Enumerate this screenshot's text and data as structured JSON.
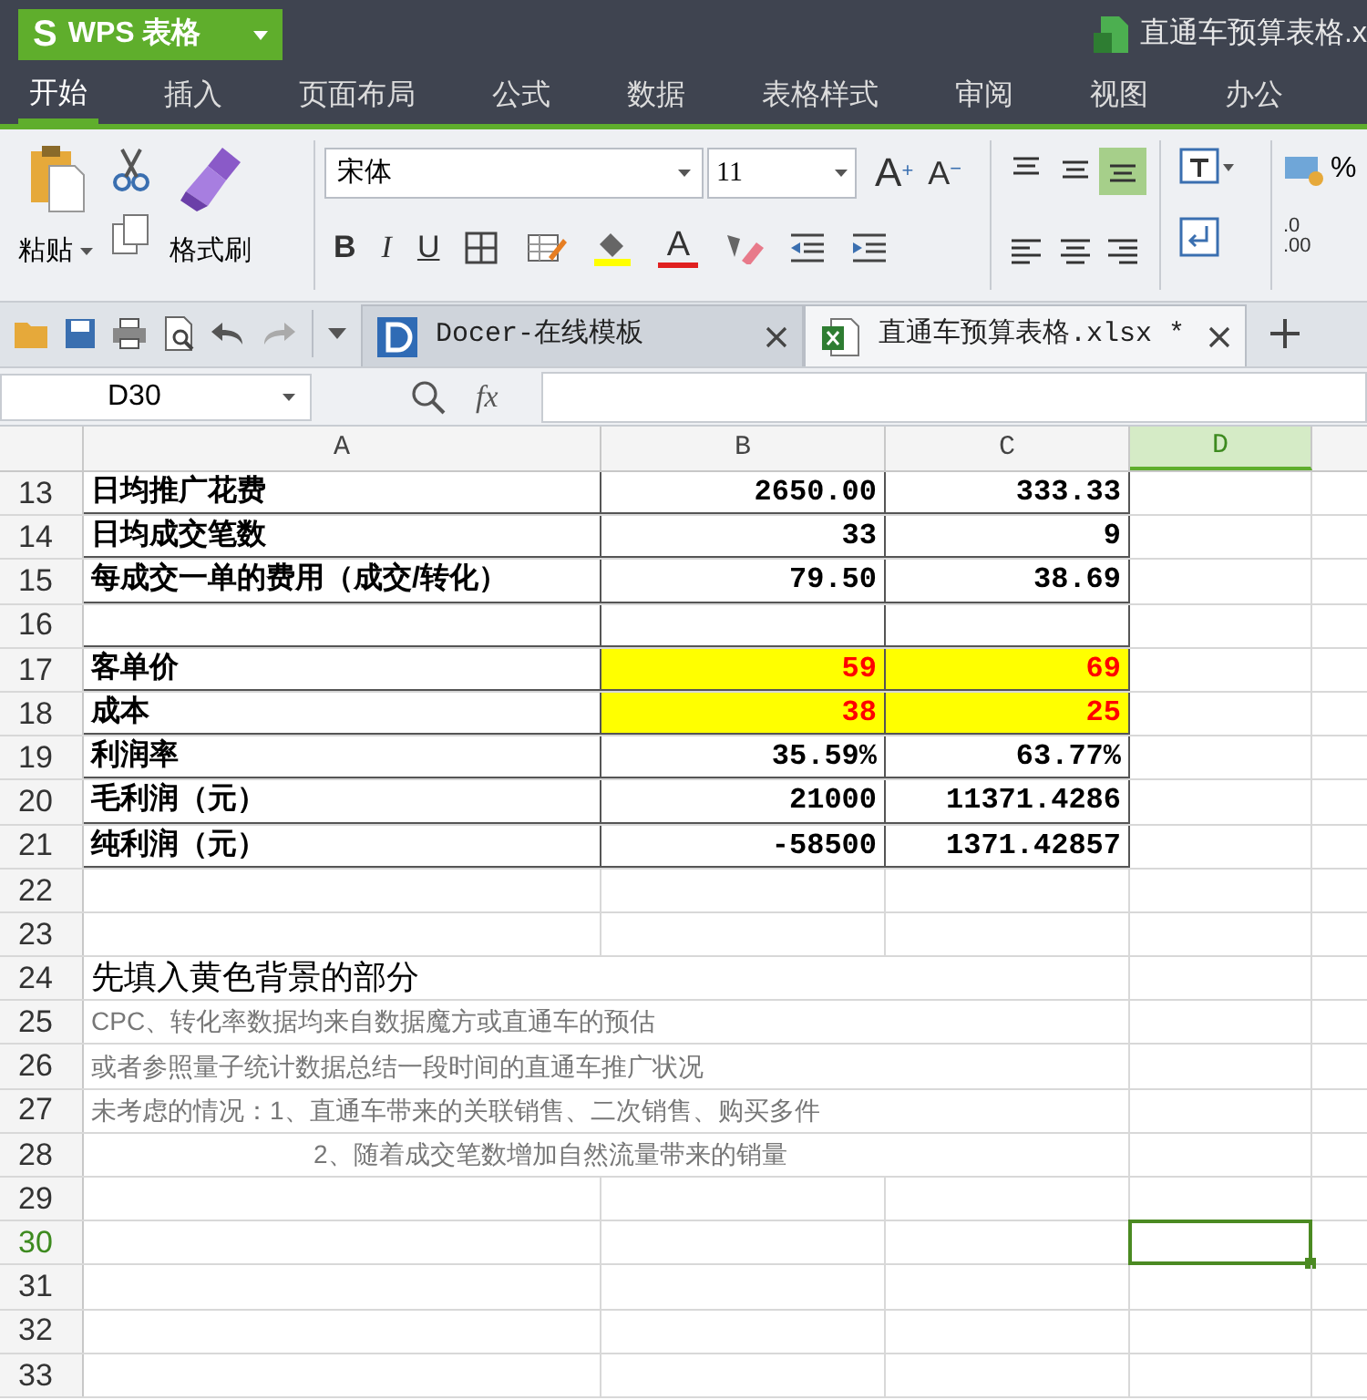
{
  "app": {
    "logo_mark": "S",
    "logo": "WPS 表格",
    "file_title": "直通车预算表格.x"
  },
  "menu_tabs": [
    {
      "label": "开始",
      "selected": true
    },
    {
      "label": "插入",
      "selected": false
    },
    {
      "label": "页面布局",
      "selected": false
    },
    {
      "label": "公式",
      "selected": false
    },
    {
      "label": "数据",
      "selected": false
    },
    {
      "label": "表格样式",
      "selected": false
    },
    {
      "label": "审阅",
      "selected": false
    },
    {
      "label": "视图",
      "selected": false
    },
    {
      "label": "办公",
      "selected": false
    }
  ],
  "ribbon": {
    "paste": "粘贴",
    "format_painter": "格式刷",
    "font": "宋体",
    "font_size": "11",
    "grow": "A",
    "grow_sign": "+",
    "shrink": "A",
    "shrink_sign": "−",
    "bold": "B",
    "italic": "I",
    "underline": "U",
    "font_color": "A",
    "percent": "%",
    "decimal_more": ".0",
    "decimal_more_2": ".00"
  },
  "doc_tabs": [
    {
      "label": "Docer-在线模板",
      "kind": "docer",
      "selected": false
    },
    {
      "label": "直通车预算表格.xlsx *",
      "kind": "sheet",
      "selected": true
    }
  ],
  "formula_bar": {
    "cell_ref": "D30",
    "fx": "fx"
  },
  "columns": [
    {
      "label": "A",
      "selected": false
    },
    {
      "label": "B",
      "selected": false
    },
    {
      "label": "C",
      "selected": false
    },
    {
      "label": "D",
      "selected": true
    }
  ],
  "rows": [
    {
      "number": "13",
      "kind": "table",
      "selected": false,
      "cells": [
        {
          "text": "日均推广花费",
          "input": false
        },
        {
          "text": "2650.00",
          "input": false
        },
        {
          "text": "333.33",
          "input": false
        }
      ]
    },
    {
      "number": "14",
      "kind": "table",
      "selected": false,
      "cells": [
        {
          "text": "日均成交笔数",
          "input": false
        },
        {
          "text": "33",
          "input": false
        },
        {
          "text": "9",
          "input": false
        }
      ]
    },
    {
      "number": "15",
      "kind": "table",
      "selected": false,
      "cells": [
        {
          "text": "每成交一单的费用（成交/转化）",
          "input": false
        },
        {
          "text": "79.50",
          "input": false
        },
        {
          "text": "38.69",
          "input": false
        }
      ]
    },
    {
      "number": "16",
      "kind": "table",
      "selected": false,
      "cells": []
    },
    {
      "number": "17",
      "kind": "table",
      "selected": false,
      "cells": [
        {
          "text": "客单价",
          "input": false
        },
        {
          "text": "59",
          "input": true
        },
        {
          "text": "69",
          "input": true
        }
      ]
    },
    {
      "number": "18",
      "kind": "table",
      "selected": false,
      "cells": [
        {
          "text": "成本",
          "input": false
        },
        {
          "text": "38",
          "input": true
        },
        {
          "text": "25",
          "input": true
        }
      ]
    },
    {
      "number": "19",
      "kind": "table",
      "selected": false,
      "cells": [
        {
          "text": "利润率",
          "input": false
        },
        {
          "text": "35.59%",
          "input": false
        },
        {
          "text": "63.77%",
          "input": false
        }
      ]
    },
    {
      "number": "20",
      "kind": "table",
      "selected": false,
      "cells": [
        {
          "text": "毛利润（元）",
          "input": false
        },
        {
          "text": "21000",
          "input": false
        },
        {
          "text": "11371.4286",
          "input": false
        }
      ]
    },
    {
      "number": "21",
      "kind": "table",
      "selected": false,
      "cells": [
        {
          "text": "纯利润（元）",
          "input": false
        },
        {
          "text": "-58500",
          "input": false
        },
        {
          "text": "1371.42857",
          "input": false
        }
      ]
    },
    {
      "number": "22",
      "kind": "blank",
      "selected": false
    },
    {
      "number": "23",
      "kind": "blank",
      "selected": false
    },
    {
      "number": "24",
      "kind": "heading",
      "selected": false,
      "text": "先填入黄色背景的部分"
    },
    {
      "number": "25",
      "kind": "note",
      "selected": false,
      "text": "CPC、转化率数据均来自数据魔方或直通车的预估"
    },
    {
      "number": "26",
      "kind": "note",
      "selected": false,
      "text": "或者参照量子统计数据总结一段时间的直通车推广状况"
    },
    {
      "number": "27",
      "kind": "note",
      "selected": false,
      "text": "未考虑的情况：1、直通车带来的关联销售、二次销售、购买多件"
    },
    {
      "number": "28",
      "kind": "note_continued",
      "selected": false,
      "text": "2、随着成交笔数增加自然流量带来的销量"
    },
    {
      "number": "29",
      "kind": "blank",
      "selected": false
    },
    {
      "number": "30",
      "kind": "blank",
      "selected": true
    },
    {
      "number": "31",
      "kind": "blank",
      "selected": false
    },
    {
      "number": "32",
      "kind": "blank",
      "selected": false
    },
    {
      "number": "33",
      "kind": "blank",
      "selected": false
    }
  ]
}
